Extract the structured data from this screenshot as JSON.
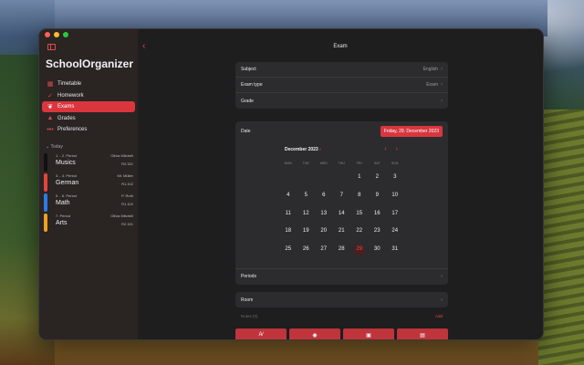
{
  "app": {
    "title": "SchoolOrganizer"
  },
  "sidebar": {
    "items": [
      {
        "label": "Timetable",
        "icon": "calendar-icon",
        "active": false
      },
      {
        "label": "Homework",
        "icon": "check-icon",
        "active": false
      },
      {
        "label": "Exams",
        "icon": "leaf-icon",
        "active": true
      },
      {
        "label": "Grades",
        "icon": "graduation-cap-icon",
        "active": false
      },
      {
        "label": "Preferences",
        "icon": "dots-icon",
        "active": false
      }
    ],
    "today_header": "Today",
    "lessons": [
      {
        "period": "1. - 2. Period",
        "teacher": "Olivia Mitchell",
        "subject": "Musics",
        "room": "R2.321",
        "color": "#111111"
      },
      {
        "period": "3. - 4. Period",
        "teacher": "Mr. Müller",
        "subject": "German",
        "room": "R1.102",
        "color": "#e2453c"
      },
      {
        "period": "5. - 6. Period",
        "teacher": "P. Roth",
        "subject": "Math",
        "room": "R1.102",
        "color": "#2f7ae5"
      },
      {
        "period": "7. Period",
        "teacher": "Olivia Mitchell",
        "subject": "Arts",
        "room": "R2.321",
        "color": "#f0a020"
      }
    ]
  },
  "main": {
    "title": "Exam",
    "form": {
      "subject_label": "Subject",
      "subject_value": "English",
      "exam_type_label": "Exam type",
      "exam_type_value": "Exam",
      "grade_label": "Grade",
      "date_label": "Date",
      "date_value": "Friday, 29. December 2023",
      "periods_label": "Periods",
      "room_label": "Room",
      "notes_label": "Notes (0)",
      "notes_add": "Add"
    },
    "calendar": {
      "month": "December 2023",
      "weekdays": [
        "MON",
        "TUE",
        "WED",
        "THU",
        "FRI",
        "SAT",
        "SUN"
      ],
      "selected_day": 29,
      "weeks": [
        [
          "",
          "",
          "",
          "",
          "1",
          "2",
          "3"
        ],
        [
          "4",
          "5",
          "6",
          "7",
          "8",
          "9",
          "10"
        ],
        [
          "11",
          "12",
          "13",
          "14",
          "15",
          "16",
          "17"
        ],
        [
          "18",
          "19",
          "20",
          "21",
          "22",
          "23",
          "24"
        ],
        [
          "25",
          "26",
          "27",
          "28",
          "29",
          "30",
          "31"
        ]
      ]
    },
    "toolbar": [
      {
        "icon": "text-format-icon",
        "glyph": "A⁄"
      },
      {
        "icon": "camera-icon",
        "glyph": "◉"
      },
      {
        "icon": "photos-icon",
        "glyph": "▣"
      },
      {
        "icon": "document-icon",
        "glyph": "▤"
      }
    ]
  }
}
